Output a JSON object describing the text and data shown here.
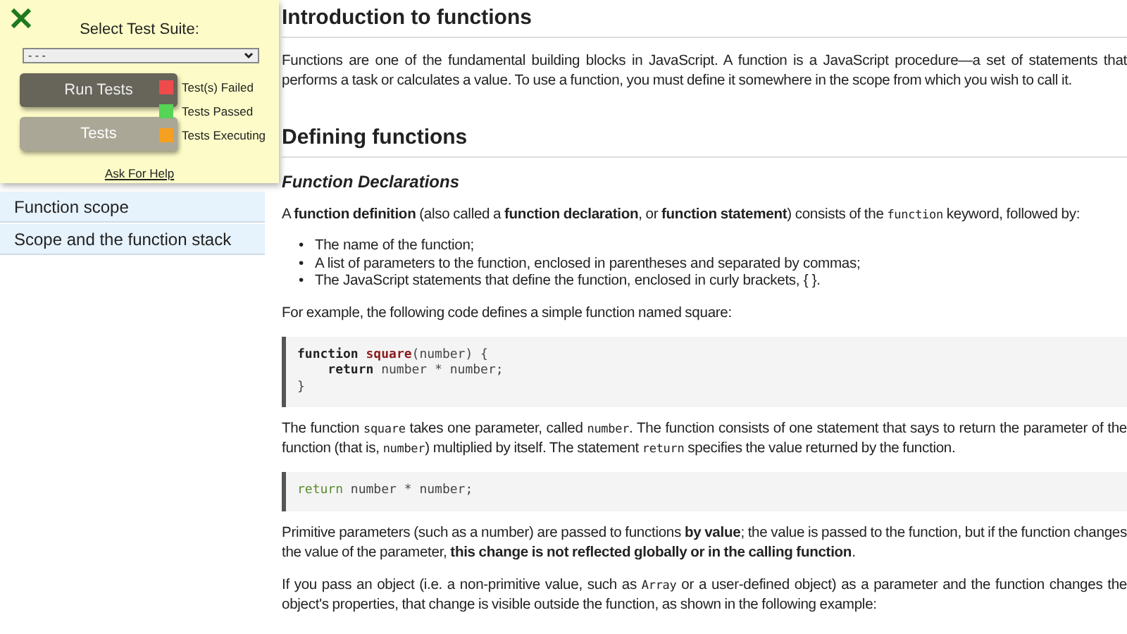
{
  "test_panel": {
    "title": "Select Test Suite:",
    "suite_select": {
      "value": "- - -"
    },
    "buttons": [
      {
        "label": "Run Tests",
        "kind": "primary"
      },
      {
        "label": "Tests",
        "kind": "secondary"
      }
    ],
    "legend": [
      {
        "label": "Test(s) Failed",
        "color": "#f04b4b"
      },
      {
        "label": "Tests Passed",
        "color": "#55d455"
      },
      {
        "label": "Tests Executing",
        "color": "#f5a020"
      }
    ],
    "help_link": "Ask For Help"
  },
  "sidebar": {
    "items": [
      {
        "label": "Function scope"
      },
      {
        "label": "Scope and the function stack"
      }
    ]
  },
  "content": [
    {
      "kind": "h2",
      "text": "Introduction to functions"
    },
    {
      "kind": "p",
      "segments": [
        {
          "kind": "text",
          "text": "Functions are one of the fundamental building blocks in JavaScript. A function is a JavaScript procedure—a set of statements that performs a task or calculates a value. To use a function, you must define it somewhere in the scope from which you wish to call it."
        }
      ]
    },
    {
      "kind": "h2",
      "text": "Defining functions"
    },
    {
      "kind": "h3",
      "text": "Function Declarations"
    },
    {
      "kind": "p",
      "segments": [
        {
          "kind": "text",
          "text": "A "
        },
        {
          "kind": "bold",
          "text": "function definition"
        },
        {
          "kind": "text",
          "text": " (also called a "
        },
        {
          "kind": "bold",
          "text": "function declaration"
        },
        {
          "kind": "text",
          "text": ", or "
        },
        {
          "kind": "bold",
          "text": "function statement"
        },
        {
          "kind": "text",
          "text": ") consists of the "
        },
        {
          "kind": "code",
          "text": "function"
        },
        {
          "kind": "text",
          "text": " keyword, followed by:"
        }
      ]
    },
    {
      "kind": "ul",
      "items": [
        {
          "marker": "•",
          "text": "The name of the function;"
        },
        {
          "marker": "•",
          "text": "A list of parameters to the function, enclosed in parentheses and separated by commas;"
        },
        {
          "marker": "•",
          "text": "The JavaScript statements that define the function, enclosed in curly brackets, { }."
        }
      ]
    },
    {
      "kind": "p",
      "segments": [
        {
          "kind": "text",
          "text": "For example, the following code defines a simple function named square:"
        }
      ]
    },
    {
      "kind": "code",
      "lines": [
        {
          "indented": false,
          "tokens": [
            {
              "kind": "keyword",
              "text": "function"
            },
            {
              "kind": "name",
              "text": "square"
            },
            {
              "kind": "plain",
              "text": "(number) {"
            }
          ]
        },
        {
          "indented": true,
          "tokens": [
            {
              "kind": "keyword",
              "text": "return"
            },
            {
              "kind": "plain",
              "text": "number * number;"
            }
          ]
        },
        {
          "indented": false,
          "tokens": [
            {
              "kind": "plain",
              "text": "}"
            }
          ]
        }
      ]
    },
    {
      "kind": "p",
      "segments": [
        {
          "kind": "text",
          "text": "The function "
        },
        {
          "kind": "code",
          "text": "square"
        },
        {
          "kind": "text",
          "text": " takes one parameter, called "
        },
        {
          "kind": "code",
          "text": "number"
        },
        {
          "kind": "text",
          "text": ". The function consists of one statement that says to return the parameter of the function (that is, "
        },
        {
          "kind": "code",
          "text": "number"
        },
        {
          "kind": "text",
          "text": ") multiplied by itself. The statement "
        },
        {
          "kind": "code",
          "text": "return"
        },
        {
          "kind": "text",
          "text": " specifies the value returned by the function."
        }
      ]
    },
    {
      "kind": "code",
      "lines": [
        {
          "indented": false,
          "tokens": [
            {
              "kind": "return",
              "text": "return"
            },
            {
              "kind": "plain",
              "text": "number * number;"
            }
          ]
        }
      ]
    },
    {
      "kind": "p",
      "segments": [
        {
          "kind": "text",
          "text": "Primitive parameters (such as a number) are passed to functions "
        },
        {
          "kind": "bold",
          "text": "by value"
        },
        {
          "kind": "text",
          "text": "; the value is passed to the function, but if the function changes the value of the parameter, "
        },
        {
          "kind": "bold",
          "text": "this change is not reflected globally or in the calling function"
        },
        {
          "kind": "text",
          "text": "."
        }
      ]
    },
    {
      "kind": "p",
      "segments": [
        {
          "kind": "text",
          "text": "If you pass an object (i.e. a non-primitive value, such as "
        },
        {
          "kind": "code",
          "text": "Array"
        },
        {
          "kind": "text",
          "text": " or a user-defined object) as a parameter and the function changes the object's properties, that change is visible outside the function, as shown in the following example:"
        }
      ]
    }
  ]
}
